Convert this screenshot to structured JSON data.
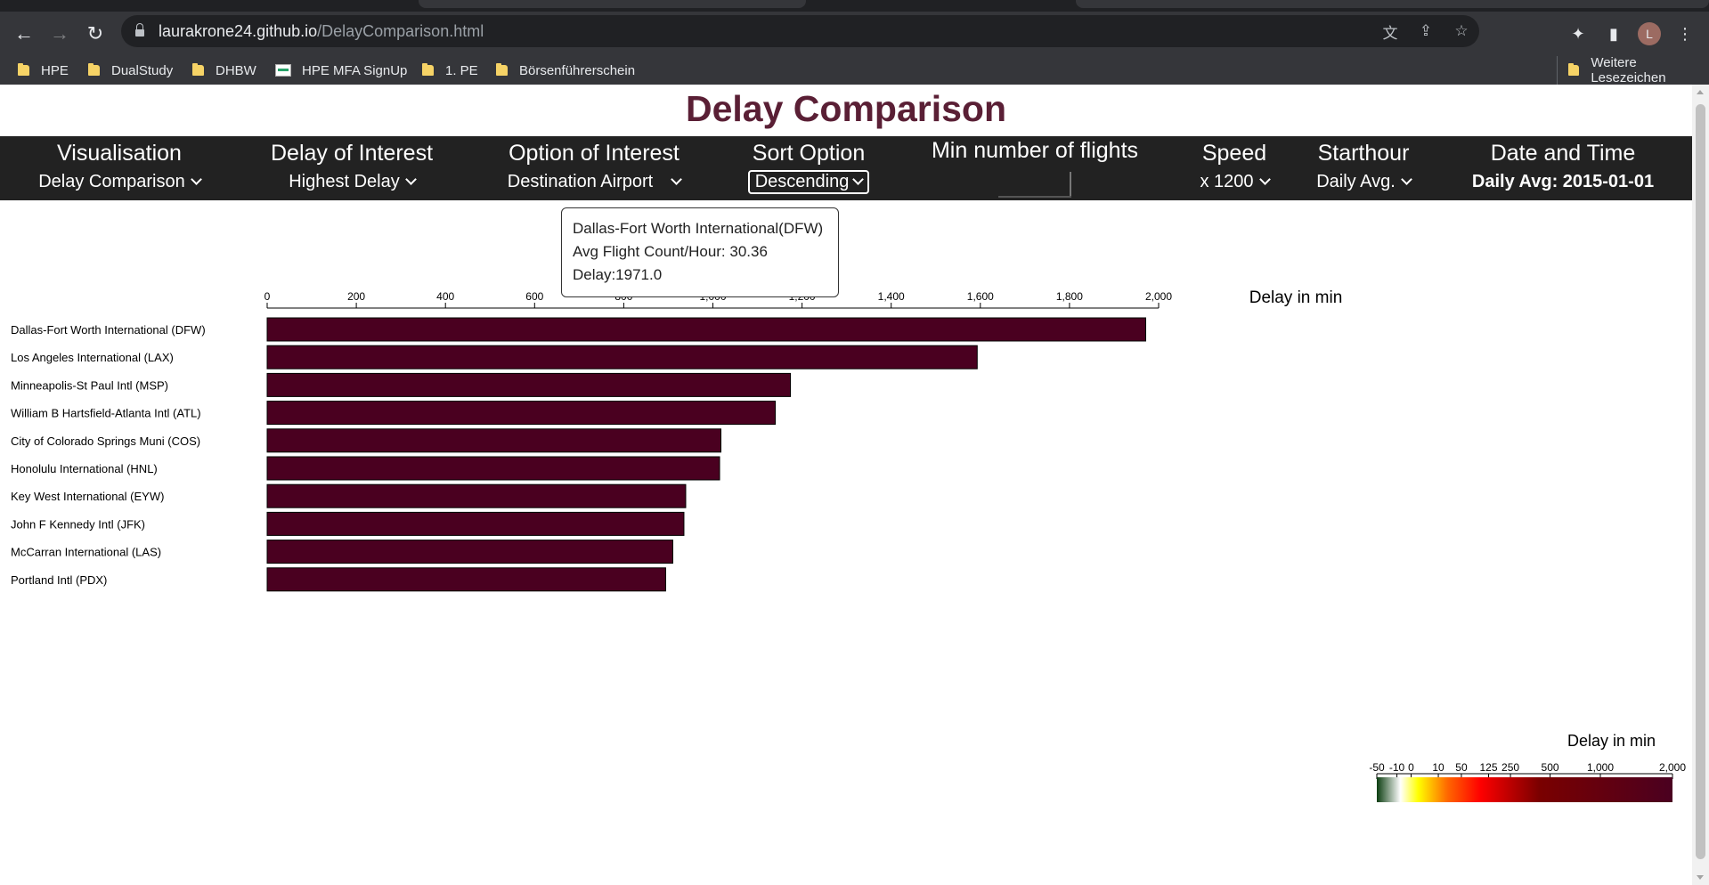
{
  "browser": {
    "url_host": "laurakrone24.github.io",
    "url_path": "/DelayComparison.html",
    "avatar_letter": "L",
    "bookmarks": [
      {
        "label": "HPE",
        "icon": "folder-icon"
      },
      {
        "label": "DualStudy",
        "icon": "folder-icon"
      },
      {
        "label": "DHBW",
        "icon": "folder-icon"
      },
      {
        "label": "HPE MFA SignUp",
        "icon": "page-icon"
      },
      {
        "label": "1. PE",
        "icon": "folder-icon"
      },
      {
        "label": "Börsenführerschein",
        "icon": "folder-icon"
      }
    ],
    "other_bookmarks": "Weitere Lesezeichen"
  },
  "page": {
    "title": "Delay Comparison",
    "controls": {
      "visualisation": {
        "label": "Visualisation",
        "value": "Delay Comparison"
      },
      "delay_of_interest": {
        "label": "Delay of Interest",
        "value": "Highest Delay"
      },
      "option_of_interest": {
        "label": "Option of Interest",
        "value": "Destination Airport"
      },
      "sort_option": {
        "label": "Sort Option",
        "value": "Descending"
      },
      "min_flights": {
        "label": "Min number of flights"
      },
      "speed": {
        "label": "Speed",
        "value": "x 1200"
      },
      "starthour": {
        "label": "Starthour",
        "value": "Daily Avg."
      },
      "date_time": {
        "label": "Date and Time",
        "value": "Daily Avg: 2015-01-01"
      }
    },
    "tooltip": {
      "line1": "Dallas-Fort Worth International(DFW)",
      "line2": "Avg Flight Count/Hour: 30.36",
      "line3": "Delay:1971.0"
    },
    "legend": {
      "title": "Delay in min",
      "ticks": [
        "-50",
        "-10",
        "0",
        "10",
        "50",
        "125",
        "250",
        "500",
        "1,000",
        "2,000"
      ],
      "tick_values": [
        -50,
        -10,
        0,
        10,
        50,
        125,
        250,
        500,
        1000,
        2000
      ],
      "colors": [
        "#0b3d10",
        "#ffffff",
        "#ffff00",
        "#ff6600",
        "#ff0000",
        "#7a0000",
        "#4a0020"
      ]
    }
  },
  "chart_data": {
    "type": "bar",
    "orientation": "horizontal",
    "xlabel": "Delay in min",
    "xlim": [
      0,
      2000
    ],
    "ticks": [
      0,
      200,
      400,
      600,
      800,
      1000,
      1200,
      1400,
      1600,
      1800,
      2000
    ],
    "tick_labels": [
      "0",
      "200",
      "400",
      "600",
      "800",
      "1,000",
      "1,200",
      "1,400",
      "1,600",
      "1,800",
      "2,000"
    ],
    "bar_color": "#4a0020",
    "categories": [
      "Dallas-Fort Worth International (DFW)",
      "Los Angeles International (LAX)",
      "Minneapolis-St Paul Intl (MSP)",
      "William B Hartsfield-Atlanta Intl (ATL)",
      "City of Colorado Springs Muni (COS)",
      "Honolulu International (HNL)",
      "Key West International (EYW)",
      "John F Kennedy Intl (JFK)",
      "McCarran International (LAS)",
      "Portland Intl (PDX)"
    ],
    "values": [
      1971,
      1593,
      1174,
      1140,
      1018,
      1015,
      939,
      935,
      910,
      894
    ]
  }
}
